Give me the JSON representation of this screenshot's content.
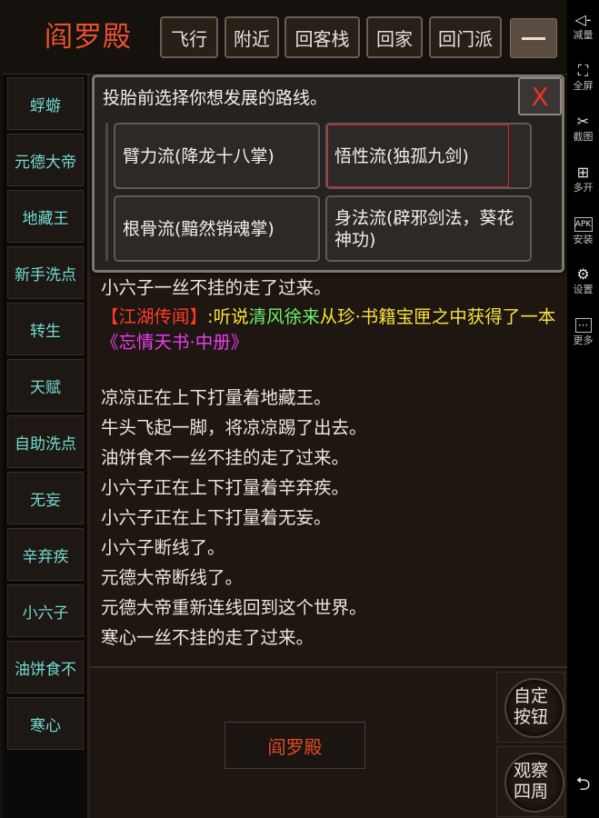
{
  "header": {
    "room_title": "阎罗殿",
    "buttons": [
      "飞行",
      "附近",
      "回客栈",
      "回家",
      "回门派"
    ],
    "menu_icon": "hamburger-minus-icon"
  },
  "sidebar": {
    "items": [
      "蜉蝣",
      "元德大帝",
      "地藏王",
      "新手洗点",
      "转生",
      "天赋",
      "自助洗点",
      "无妄",
      "辛弃疾",
      "小六子",
      "油饼食不",
      "寒心"
    ]
  },
  "modal": {
    "prompt": "投胎前选择你想发展的路线。",
    "close_label": "X",
    "options": [
      "臂力流(降龙十八掌)",
      "悟性流(独孤九剑)",
      "根骨流(黯然销魂掌)",
      "身法流(辟邪剑法，葵花神功)"
    ]
  },
  "log": {
    "line1": "小六子一丝不挂的走了过来。",
    "news": {
      "tag": "【江湖传闻】",
      "p1": ":听说",
      "who": "清风徐来",
      "p2": "从珍·书籍宝匣之中获得了一本",
      "item": "《忘情天书·中册》"
    },
    "lines": [
      "凉凉正在上下打量着地藏王。",
      "牛头飞起一脚，将凉凉踢了出去。",
      "油饼食不一丝不挂的走了过来。",
      "小六子正在上下打量着辛弃疾。",
      "小六子正在上下打量着无妄。",
      "小六子断线了。",
      "元德大帝断线了。",
      "元德大帝重新连线回到这个世界。",
      "寒心一丝不挂的走了过来。"
    ]
  },
  "bottom": {
    "room_button": "阎罗殿",
    "custom_button": "自定按钮",
    "look_button": "观察四周"
  },
  "system_bar": {
    "items": [
      {
        "icon": "volume-down-icon",
        "label": "减量"
      },
      {
        "icon": "fullscreen-icon",
        "label": "全屏"
      },
      {
        "icon": "scissors-icon",
        "label": "截图"
      },
      {
        "icon": "multi-open-icon",
        "label": "多开"
      },
      {
        "icon": "apk-icon",
        "label": "安装"
      },
      {
        "icon": "gear-icon",
        "label": "设置"
      },
      {
        "icon": "more-icon",
        "label": "更多"
      }
    ],
    "back_icon": "back-icon"
  },
  "colors": {
    "title_red": "#e8522f",
    "sidebar_cyan": "#74d9d2",
    "news_red": "#ff3a2a",
    "news_yellow": "#f5e23c",
    "news_green": "#69f06b",
    "news_magenta": "#ea3df0"
  }
}
